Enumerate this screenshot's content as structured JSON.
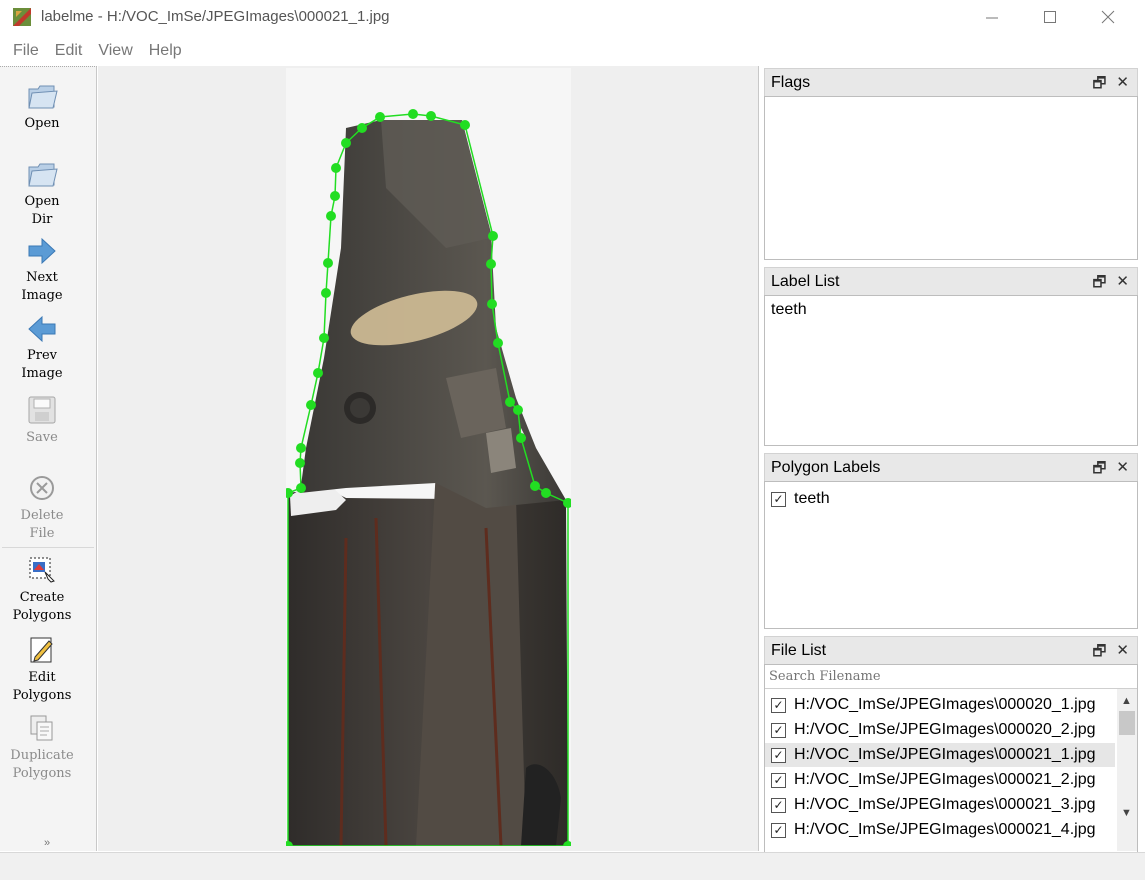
{
  "window": {
    "title": "labelme - H:/VOC_ImSe/JPEGImages\\000021_1.jpg",
    "minimize_icon": "minimize-icon",
    "maximize_icon": "maximize-icon",
    "close_icon": "close-icon"
  },
  "menu": {
    "items": [
      "File",
      "Edit",
      "View",
      "Help"
    ]
  },
  "toolbar": {
    "tools": [
      {
        "label": "Open",
        "icon": "folder-icon",
        "enabled": true
      },
      {
        "label": "Open\nDir",
        "icon": "folder-icon",
        "enabled": true
      },
      {
        "label": "Next\nImage",
        "icon": "arrow-right-icon",
        "enabled": true
      },
      {
        "label": "Prev\nImage",
        "icon": "arrow-left-icon",
        "enabled": true
      },
      {
        "label": "Save",
        "icon": "floppy-icon",
        "enabled": false
      },
      {
        "label": "Delete\nFile",
        "icon": "delete-icon",
        "enabled": false
      },
      {
        "label": "Create\nPolygons",
        "icon": "create-polygon-icon",
        "enabled": true
      },
      {
        "label": "Edit\nPolygons",
        "icon": "edit-icon",
        "enabled": true
      },
      {
        "label": "Duplicate\nPolygons",
        "icon": "copy-icon",
        "enabled": false
      }
    ],
    "more_icon": "double-chevron-down-icon"
  },
  "canvas": {
    "polygon_color": "#22dd22",
    "polygon_label": "teeth"
  },
  "docks": {
    "flags": {
      "title": "Flags"
    },
    "label_list": {
      "title": "Label List",
      "items": [
        "teeth"
      ]
    },
    "polygon_labels": {
      "title": "Polygon Labels",
      "items": [
        {
          "label": "teeth",
          "checked": true
        }
      ]
    },
    "file_list": {
      "title": "File List",
      "search_placeholder": "Search Filename",
      "files": [
        {
          "path": "H:/VOC_ImSe/JPEGImages\\000020_1.jpg",
          "checked": true,
          "selected": false
        },
        {
          "path": "H:/VOC_ImSe/JPEGImages\\000020_2.jpg",
          "checked": true,
          "selected": false
        },
        {
          "path": "H:/VOC_ImSe/JPEGImages\\000021_1.jpg",
          "checked": true,
          "selected": true
        },
        {
          "path": "H:/VOC_ImSe/JPEGImages\\000021_2.jpg",
          "checked": true,
          "selected": false
        },
        {
          "path": "H:/VOC_ImSe/JPEGImages\\000021_3.jpg",
          "checked": true,
          "selected": false
        },
        {
          "path": "H:/VOC_ImSe/JPEGImages\\000021_4.jpg",
          "checked": true,
          "selected": false
        }
      ]
    },
    "float_icon": "float-icon",
    "close_icon": "close-icon"
  }
}
